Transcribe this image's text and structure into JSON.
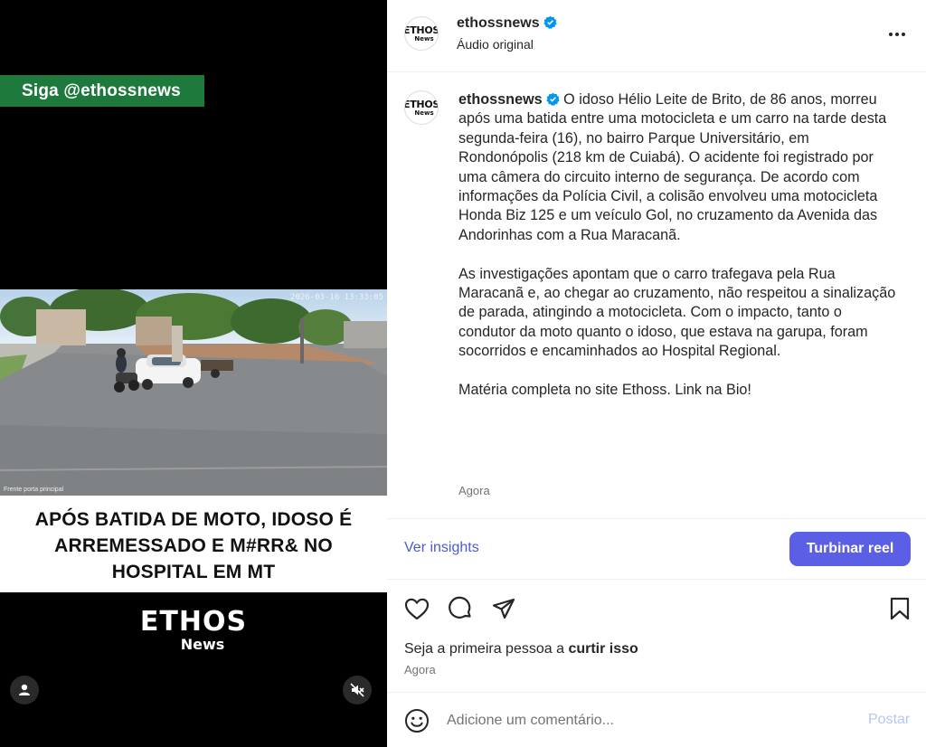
{
  "video": {
    "follow_banner": "Siga @ethossnews",
    "timestamp": "2026-03-16 13:33:05",
    "camera_label": "Frente porta principal",
    "headline": "APÓS BATIDA DE MOTO, IDOSO É ARREMESSADO E M#RR& NO HOSPITAL EM MT",
    "logo_main": "ETHOS",
    "logo_sub": "News",
    "colors": {
      "banner": "#1e7a3c"
    },
    "icons": {
      "profile_tag": "person-icon",
      "mute": "speaker-muted-icon"
    }
  },
  "header": {
    "avatar_text_top": "ETHOS",
    "avatar_text_bottom": "News",
    "username": "ethossnews",
    "audio": "Áudio original",
    "icons": {
      "verified": "verified-badge-icon",
      "more": "more-options-icon"
    }
  },
  "caption": {
    "username": "ethossnews",
    "paragraph_1": "O idoso Hélio Leite de Brito, de 86 anos, morreu após uma batida entre uma motocicleta e um carro na tarde desta segunda-feira (16), no bairro Parque Universitário, em Rondonópolis (218 km de Cuiabá). O acidente foi registrado por uma câmera do circuito interno de segurança. De acordo com informações da Polícia Civil, a colisão envolveu uma motocicleta Honda Biz 125 e um veículo Gol, no cruzamento da Avenida das Andorinhas com a Rua Maracanã.",
    "paragraph_2": "As investigações apontam que o carro trafegava pela Rua Maracanã e, ao chegar ao cruzamento, não respeitou a sinalização de parada, atingindo a motocicleta. Com o impacto, tanto o condutor da moto quanto o idoso, que estava na garupa, foram socorridos e encaminhados ao Hospital Regional.",
    "paragraph_3": "Matéria completa no site Ethoss. Link na Bio!",
    "time": "Agora"
  },
  "insights": {
    "link_label": "Ver insights",
    "boost_label": "Turbinar reel",
    "colors": {
      "link": "#4a5ad7",
      "boost": "#5b5fe6"
    }
  },
  "actions": {
    "icons": {
      "like": "heart-icon",
      "comment": "comment-icon",
      "share": "share-icon",
      "save": "bookmark-icon"
    },
    "likes_prefix": "Seja a primeira pessoa a ",
    "likes_action": "curtir isso",
    "time": "Agora"
  },
  "comment": {
    "placeholder": "Adicione um comentário...",
    "post_label": "Postar",
    "icons": {
      "emoji": "emoji-smiley-icon"
    }
  }
}
